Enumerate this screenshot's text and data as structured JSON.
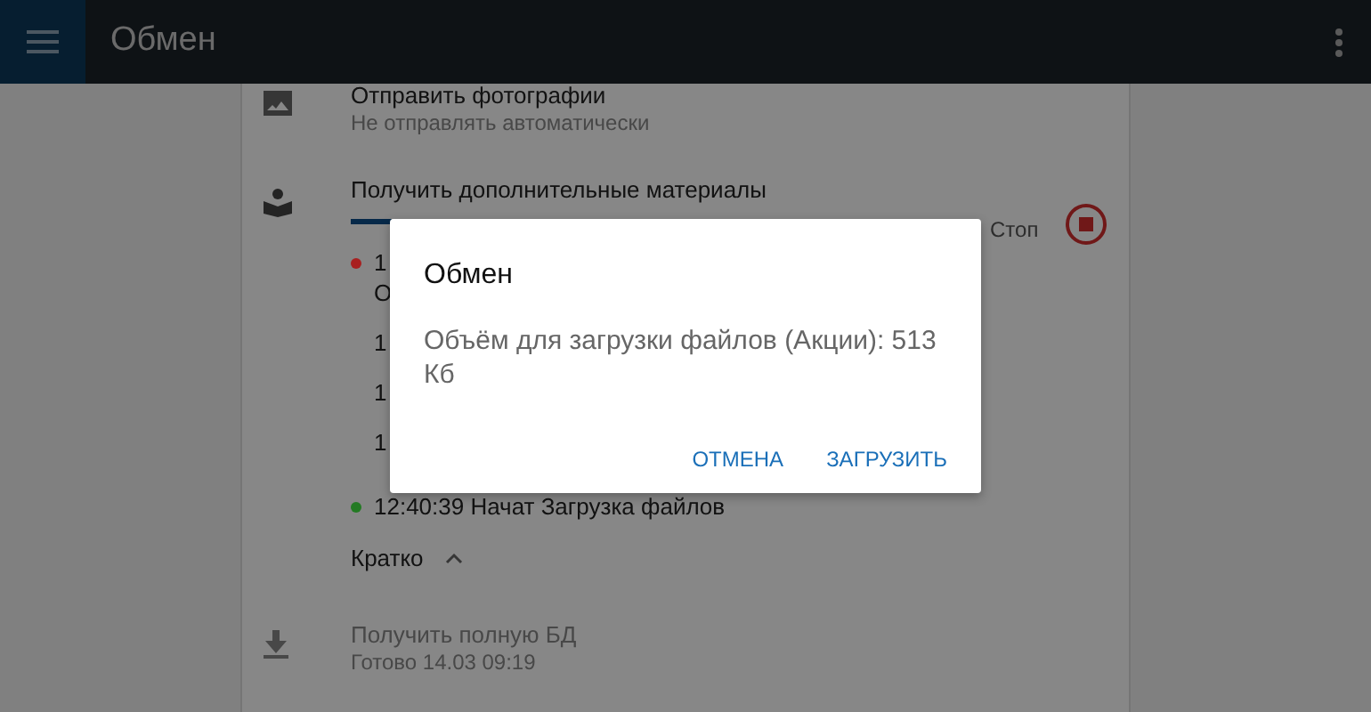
{
  "app_bar": {
    "title": "Обмен"
  },
  "sections": [
    {
      "kind": "photo",
      "title": "Отправить фотографии",
      "subtitle": "Не отправлять автоматически"
    },
    {
      "kind": "progress",
      "title": "Получить дополнительные материалы",
      "stop_label": "Стоп",
      "level": 0.07,
      "log": [
        {
          "text": "1",
          "color": "#a82020"
        },
        {
          "text": "О"
        },
        {
          "text": "1"
        },
        {
          "text": "1"
        },
        {
          "text": "1"
        },
        {
          "text": "12:40:39 Начат Загрузка файлов",
          "color": "#237a23"
        }
      ],
      "summary_toggle": {
        "label": "Кратко",
        "expanded": true
      }
    },
    {
      "kind": "download",
      "title": "Получить полную БД",
      "subtitle": "Готово 14.03 09:19"
    }
  ],
  "dialog": {
    "title": "Обмен",
    "message": "Объём для загрузки файлов (Акции): 513 Кб",
    "buttons": [
      "ОТМЕНА",
      "ЗАГРУЗИТЬ"
    ]
  }
}
